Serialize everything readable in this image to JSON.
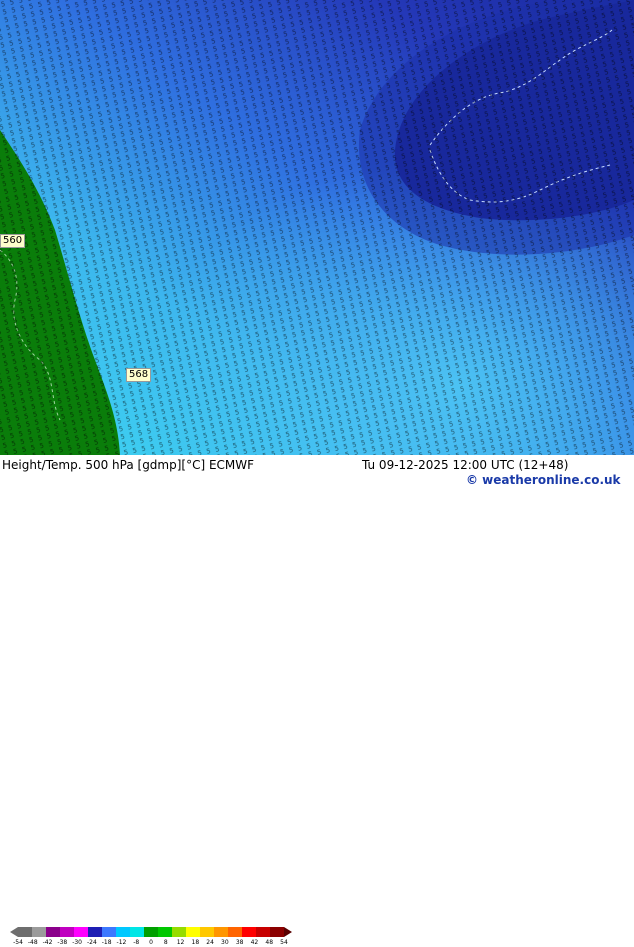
{
  "map": {
    "contour_labels": [
      {
        "text": "560",
        "fx": 0.0,
        "fy": 0.515
      },
      {
        "text": "568",
        "fx": 0.198,
        "fy": 0.808
      }
    ]
  },
  "footer": {
    "title": "Height/Temp. 500 hPa [gdmp][°C] ECMWF",
    "datetime": "Tu 09-12-2025 12:00 UTC (12+48)",
    "credit": "© weatheronline.co.uk"
  },
  "legend": {
    "ticks": [
      "-54",
      "-48",
      "-42",
      "-38",
      "-30",
      "-24",
      "-18",
      "-12",
      "-8",
      "0",
      "8",
      "12",
      "18",
      "24",
      "30",
      "38",
      "42",
      "48",
      "54"
    ],
    "colors": [
      "#6e6e6e",
      "#9b9b9b",
      "#8b008b",
      "#c000c0",
      "#ff00ff",
      "#1e1eb4",
      "#3c78ff",
      "#00c8ff",
      "#00e6e6",
      "#00a000",
      "#00c800",
      "#96dc00",
      "#ffff00",
      "#ffc800",
      "#ff9600",
      "#ff6400",
      "#ff0000",
      "#c80000",
      "#8b0000"
    ]
  },
  "colors": {
    "deep_navy": "#141e8c",
    "blue": "#3246d2",
    "light_blue": "#46a0f0",
    "cyan": "#3cd2f0",
    "green": "#0a7d0a"
  }
}
